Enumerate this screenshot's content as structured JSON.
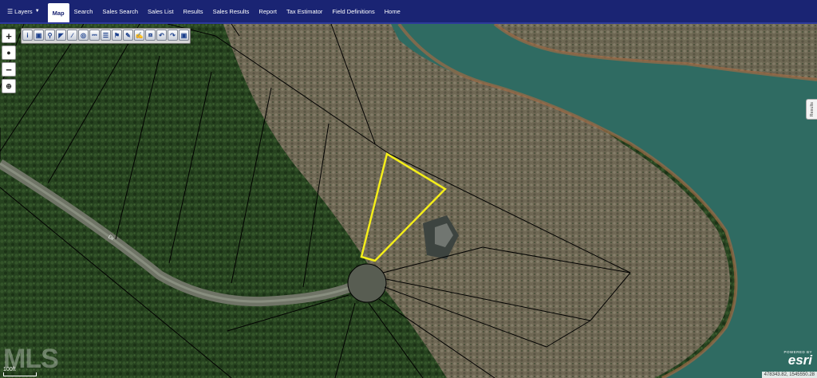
{
  "navbar": {
    "layers_label": "Layers",
    "items": [
      "Map",
      "Search",
      "Sales Search",
      "Sales List",
      "Results",
      "Sales Results",
      "Report",
      "Tax Estimator",
      "Field Definitions",
      "Home"
    ],
    "active": "Map"
  },
  "map_controls": {
    "zoom_in": "+",
    "zoom_out": "−",
    "globe_icon": "globe-icon",
    "locate_icon": "crosshair-icon"
  },
  "toolbar_icons": [
    "info-icon",
    "identify-icon",
    "zoom-icon",
    "select-icon",
    "measure-icon",
    "buffer-icon",
    "print-icon",
    "layers-icon",
    "bookmark-icon",
    "markup-icon",
    "draw-icon",
    "extent-icon",
    "back-icon",
    "forward-icon",
    "save-icon"
  ],
  "results_tab": "Results",
  "road_label": "Dr",
  "scale": {
    "label": "100ft"
  },
  "attribution": {
    "powered_by": "POWERED BY",
    "wordmark": "esri"
  },
  "coordinates": "478343.82, 1545550.28",
  "watermark": "MLS",
  "colors": {
    "navbar": "#1a2473",
    "selected_parcel": "#f4ee1a",
    "parcel_lines": "#000000",
    "water": "#2f6b62",
    "forest": "#25401f"
  }
}
